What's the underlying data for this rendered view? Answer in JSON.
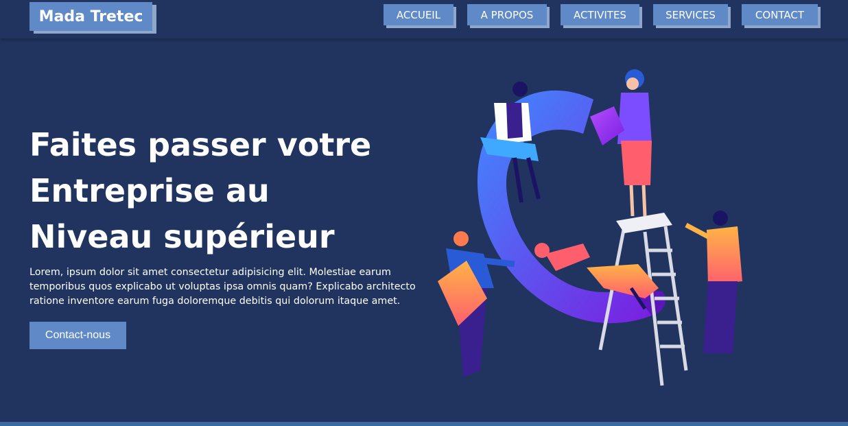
{
  "brand": {
    "name": "Mada Tretec"
  },
  "nav": {
    "items": [
      {
        "label": "ACCUEIL"
      },
      {
        "label": "A PROPOS"
      },
      {
        "label": "ACTIVITES"
      },
      {
        "label": "SERVICES"
      },
      {
        "label": "CONTACT"
      }
    ]
  },
  "hero": {
    "title_lines": [
      "Faites passer votre",
      "Entreprise au",
      "Niveau supérieur"
    ],
    "text": "Lorem, ipsum dolor sit amet consectetur adipisicing elit. Molestiae earum temporibus quos explicabo ut voluptas ipsa omnis quam? Explicabo architecto ratione inventore earum fuga doloremque debitis qui dolorum itaque amet.",
    "cta_label": "Contact-nous"
  },
  "colors": {
    "background": "#20345f",
    "accent": "#5f8ac7",
    "accent_shadow": "#90a7cc",
    "footer_strip": "#3b6aa3"
  }
}
